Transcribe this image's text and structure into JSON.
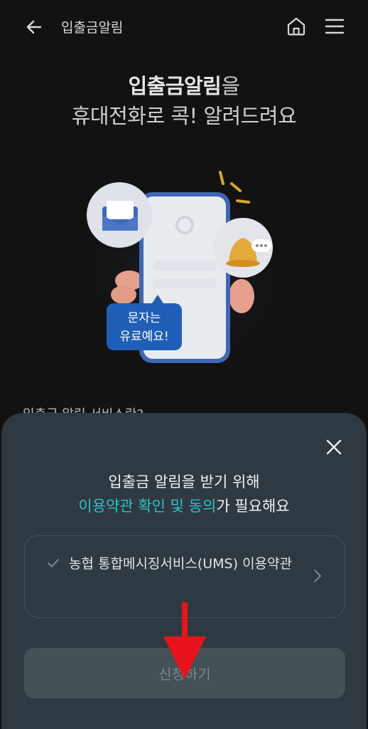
{
  "header": {
    "title": "입출금알림"
  },
  "hero": {
    "title_strong": "입출금알림",
    "title_rest": "을",
    "subtitle": "휴대전화로 콕! 알려드려요"
  },
  "illustration": {
    "bubble_line1": "문자는",
    "bubble_line2": "유료예요!"
  },
  "behind_text": "입출금 알림 서비스란?",
  "sheet": {
    "title_line1": "입출금 알림을 받기 위해",
    "title_accent": "이용약관 확인 및 동의",
    "title_rest": "가 필요해요",
    "terms_label": "농협 통합메시징서비스(UMS) 이용약관",
    "apply_label": "신청하기"
  },
  "colors": {
    "accent": "#2fc1c9",
    "sheet_bg": "#2e3941",
    "annotation_arrow": "#e8141b"
  },
  "icons": {
    "back": "arrow-left-icon",
    "home": "home-icon",
    "menu": "hamburger-icon",
    "close": "close-icon",
    "check": "check-icon",
    "chevron": "chevron-right-icon"
  }
}
